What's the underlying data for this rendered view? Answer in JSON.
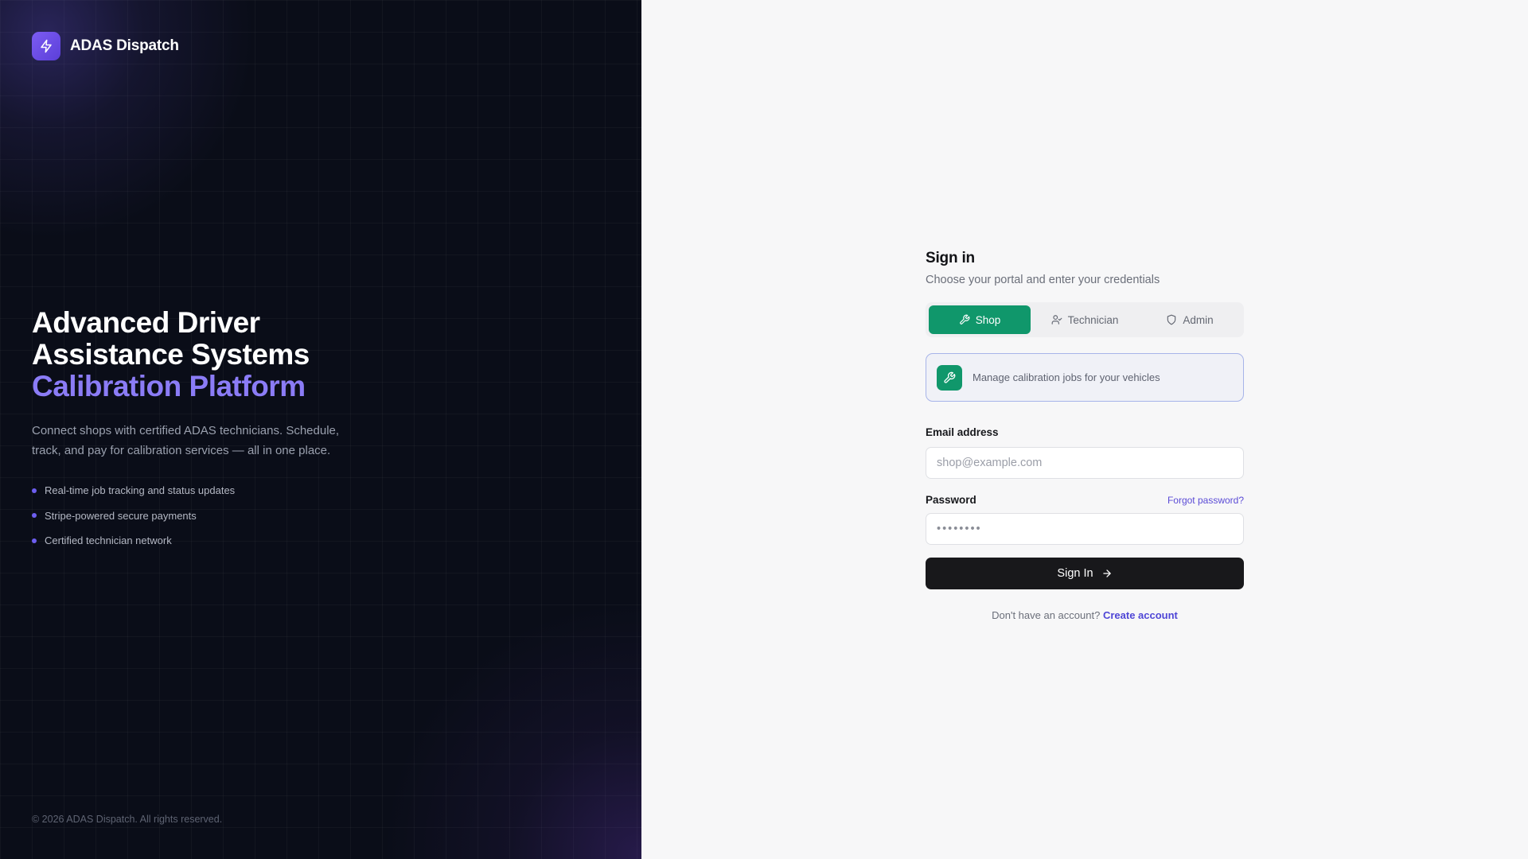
{
  "brand": {
    "name": "ADAS Dispatch",
    "logo_icon": "lightning-bolt-icon",
    "logo_color": "#6d4fe6"
  },
  "hero": {
    "title_line1": "Advanced Driver",
    "title_line2": "Assistance Systems",
    "title_accent": "Calibration Platform",
    "description": "Connect shops with certified ADAS technicians. Schedule, track, and pay for calibration services — all in one place.",
    "features": [
      "Real-time job tracking and status updates",
      "Stripe-powered secure payments",
      "Certified technician network"
    ]
  },
  "footer": {
    "copyright": "© 2026 ADAS Dispatch. All rights reserved."
  },
  "signin": {
    "title": "Sign in",
    "subtitle": "Choose your portal and enter your credentials",
    "tabs": [
      {
        "label": "Shop",
        "icon": "wrench-icon",
        "active": true
      },
      {
        "label": "Technician",
        "icon": "user-check-icon",
        "active": false
      },
      {
        "label": "Admin",
        "icon": "shield-icon",
        "active": false
      }
    ],
    "portal_description": "Manage calibration jobs for your vehicles",
    "email": {
      "label": "Email address",
      "placeholder": "shop@example.com",
      "value": ""
    },
    "password": {
      "label": "Password",
      "placeholder": "••••••••",
      "value": "",
      "forgot_label": "Forgot password?"
    },
    "submit_label": "Sign In",
    "no_account_text": "Don't have an account?",
    "create_account_label": "Create account"
  },
  "colors": {
    "accent_green": "#10976b",
    "accent_purple": "#8b7cf6",
    "button_dark": "#18181b",
    "link": "#4f46d6"
  }
}
